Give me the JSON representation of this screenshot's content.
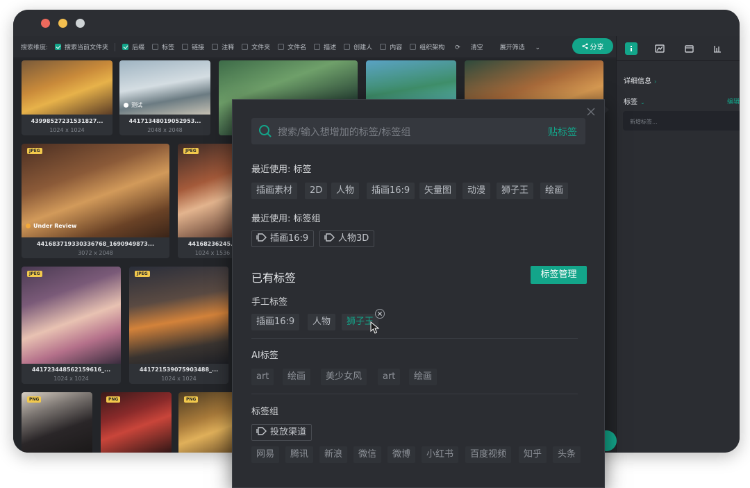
{
  "filter_bar": {
    "label": "搜索维度:",
    "options": [
      {
        "label": "搜索当前文件夹",
        "checked": true
      },
      {
        "label": "后缀",
        "checked": true
      },
      {
        "label": "标签",
        "checked": false
      },
      {
        "label": "链接",
        "checked": false
      },
      {
        "label": "注释",
        "checked": false
      },
      {
        "label": "文件夹",
        "checked": false
      },
      {
        "label": "文件名",
        "checked": false
      },
      {
        "label": "描述",
        "checked": false
      },
      {
        "label": "创建人",
        "checked": false
      },
      {
        "label": "内容",
        "checked": false
      },
      {
        "label": "组织架构",
        "checked": false
      }
    ],
    "clear_label": "清空",
    "expand_label": "展开筛选",
    "share_label": "分享"
  },
  "grid": {
    "cards": [
      {
        "name": "43998527231531827...",
        "size": "1024 x 1024",
        "badge": "",
        "overlay": ""
      },
      {
        "name": "44171348019052953...",
        "size": "2048 x 2048",
        "badge": "",
        "overlay": "测试"
      },
      {
        "name": "441683719330336768_1690949873...",
        "size": "3072 x 2048",
        "badge": "JPEG",
        "overlay": "Under Review"
      },
      {
        "name": "44168236245...",
        "size": "1024 x 1536",
        "badge": "JPEG",
        "overlay": ""
      },
      {
        "name": "441723448562159616_...",
        "size": "1024 x 1024",
        "badge": "JPEG",
        "overlay": ""
      },
      {
        "name": "441721539075903488_...",
        "size": "1024 x 1024",
        "badge": "JPEG",
        "overlay": ""
      },
      {
        "name": "",
        "size": "",
        "badge": "PNG",
        "overlay": ""
      },
      {
        "name": "",
        "size": "",
        "badge": "PNG",
        "overlay": ""
      },
      {
        "name": "",
        "size": "",
        "badge": "PNG",
        "overlay": ""
      }
    ]
  },
  "sidebar": {
    "detail_label": "详细信息",
    "tags_label": "标签",
    "edit_label": "编辑",
    "new_tag_placeholder": "新增标签..."
  },
  "popup": {
    "search_placeholder": "搜索/输入想增加的标签/标签组",
    "search_action": "贴标签",
    "recent_tags_title": "最近使用: 标签",
    "recent_tags": [
      "插画素材",
      "2D",
      "人物",
      "插画16:9",
      "矢量图",
      "动漫",
      "狮子王",
      "绘画"
    ],
    "recent_groups_title": "最近使用: 标签组",
    "recent_groups": [
      "插画16:9",
      "人物3D"
    ],
    "existing_title": "已有标签",
    "manage_button": "标签管理",
    "manual_title": "手工标签",
    "manual_tags": [
      "插画16:9",
      "人物",
      "狮子王"
    ],
    "ai_title": "AI标签",
    "ai_tags": [
      "art",
      "绘画",
      "美少女风",
      "art",
      "绘画"
    ],
    "group_title": "标签组",
    "group_name": "投放渠道",
    "group_tags": [
      "网易",
      "腾讯",
      "新浪",
      "微信",
      "微博",
      "小红书",
      "百度视频",
      "知乎",
      "头条"
    ]
  },
  "colors": {
    "accent": "#13a58a",
    "bg": "#26282d",
    "popup": "#2b2d32"
  }
}
